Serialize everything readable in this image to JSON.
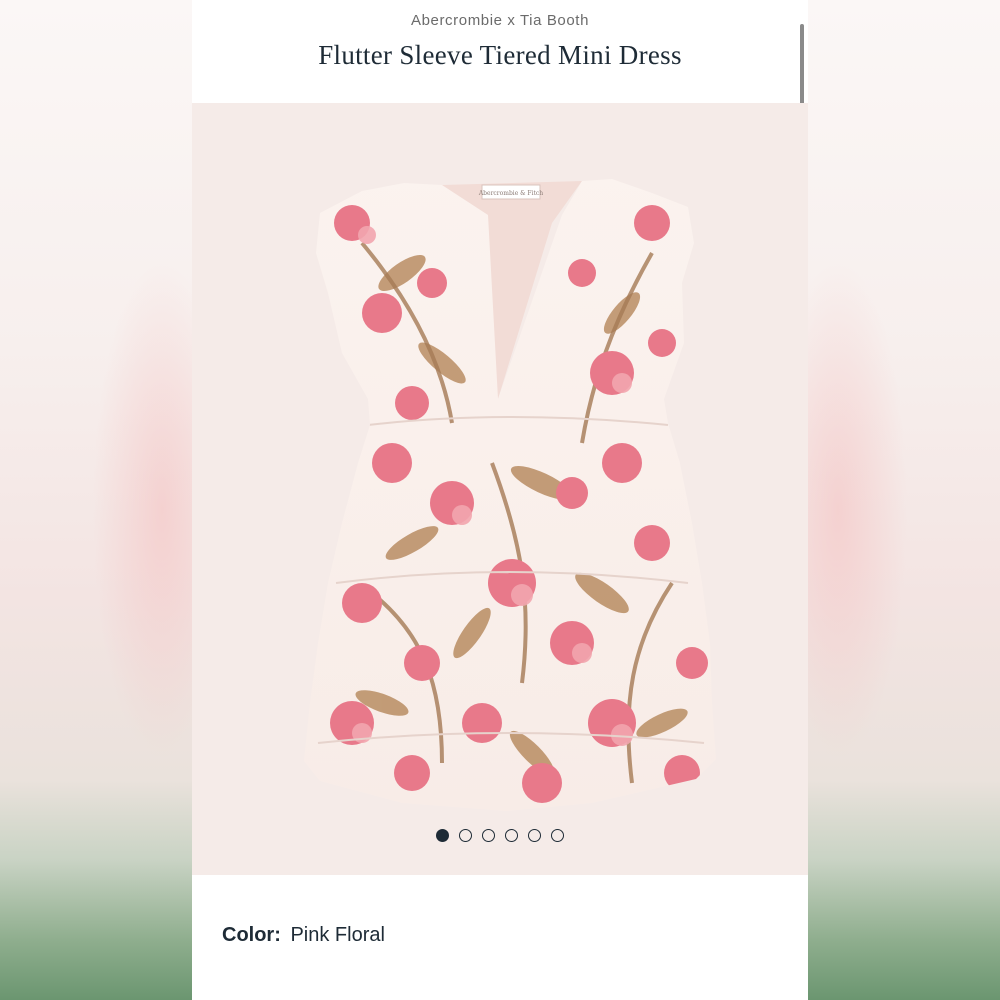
{
  "product": {
    "brand": "Abercrombie x Tia Booth",
    "title": "Flutter Sleeve Tiered Mini Dress",
    "image_alt": "Flutter sleeve tiered mini dress in pink floral print",
    "tag_text": "Abercrombie & Fitch"
  },
  "gallery": {
    "image_count": 6,
    "active_index": 0
  },
  "color": {
    "label": "Color:",
    "value": "Pink Floral"
  },
  "colors": {
    "text_dark": "#1e2b36",
    "brand_gray": "#6b6b6b",
    "gallery_bg": "#f5ebe8",
    "print_pink": "#e8798a",
    "print_tan": "#b98d63",
    "fabric_cream": "#fbf3ef"
  },
  "icons": {
    "dot": "carousel-dot-icon"
  }
}
